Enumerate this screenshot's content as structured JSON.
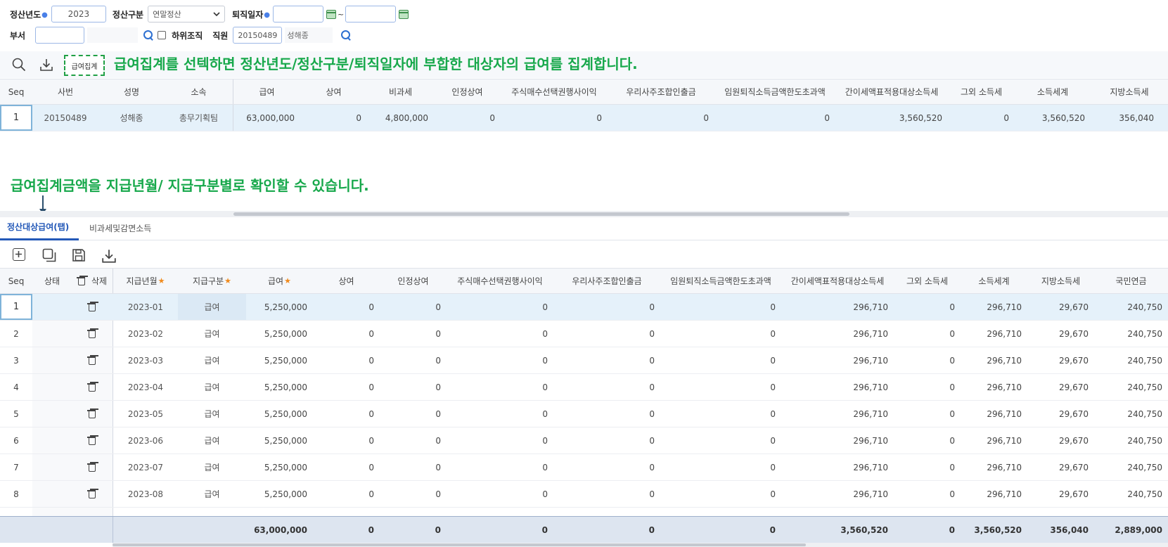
{
  "filter": {
    "year_label": "정산년도",
    "year_value": "2023",
    "type_label": "정산구분",
    "type_value": "연말정산",
    "retire_label": "퇴직일자",
    "tilde": "~",
    "dept_label": "부서",
    "sub_org_label": "하위조직",
    "emp_label": "직원",
    "emp_id": "20150489",
    "emp_name": "성해종"
  },
  "toolbar": {
    "aggregate_label": "급여집계"
  },
  "annotations": {
    "top": "급여집계를 선텍하면 정산년도/정산구분/퇴직일자에 부합한 대상자의 급여를 집계합니다.",
    "mid": "급여집계금액을 지급년월/ 지급구분별로 확인할 수 있습니다."
  },
  "top_grid": {
    "headers": [
      "Seq",
      "사번",
      "성명",
      "소속",
      "급여",
      "상여",
      "비과세",
      "인정상여",
      "주식매수선택권행사이익",
      "우리사주조합인출금",
      "임원퇴직소득금액한도초과액",
      "간이세액표적용대상소득세",
      "그외 소득세",
      "소득세계",
      "지방소득세"
    ],
    "row": [
      "1",
      "20150489",
      "성해종",
      "총무기획팀",
      "63,000,000",
      "0",
      "4,800,000",
      "0",
      "0",
      "0",
      "0",
      "3,560,520",
      "0",
      "3,560,520",
      "356,040"
    ]
  },
  "tabs": [
    "정산대상급여(탭)",
    "비과세및감면소득"
  ],
  "bottom_grid": {
    "headers": [
      "Seq",
      "상태",
      "삭제",
      "지급년월",
      "지급구분",
      "급여",
      "상여",
      "인정상여",
      "주식매수선택권행사이익",
      "우리사주조합인출금",
      "임원퇴직소득금액한도초과액",
      "간이세액표적용대상소득세",
      "그외 소득세",
      "소득세계",
      "지방소득세",
      "국민연금"
    ],
    "rows": [
      [
        "1",
        "2023-01",
        "급여",
        "5,250,000",
        "0",
        "0",
        "0",
        "0",
        "0",
        "296,710",
        "0",
        "296,710",
        "29,670",
        "240,750"
      ],
      [
        "2",
        "2023-02",
        "급여",
        "5,250,000",
        "0",
        "0",
        "0",
        "0",
        "0",
        "296,710",
        "0",
        "296,710",
        "29,670",
        "240,750"
      ],
      [
        "3",
        "2023-03",
        "급여",
        "5,250,000",
        "0",
        "0",
        "0",
        "0",
        "0",
        "296,710",
        "0",
        "296,710",
        "29,670",
        "240,750"
      ],
      [
        "4",
        "2023-04",
        "급여",
        "5,250,000",
        "0",
        "0",
        "0",
        "0",
        "0",
        "296,710",
        "0",
        "296,710",
        "29,670",
        "240,750"
      ],
      [
        "5",
        "2023-05",
        "급여",
        "5,250,000",
        "0",
        "0",
        "0",
        "0",
        "0",
        "296,710",
        "0",
        "296,710",
        "29,670",
        "240,750"
      ],
      [
        "6",
        "2023-06",
        "급여",
        "5,250,000",
        "0",
        "0",
        "0",
        "0",
        "0",
        "296,710",
        "0",
        "296,710",
        "29,670",
        "240,750"
      ],
      [
        "7",
        "2023-07",
        "급여",
        "5,250,000",
        "0",
        "0",
        "0",
        "0",
        "0",
        "296,710",
        "0",
        "296,710",
        "29,670",
        "240,750"
      ],
      [
        "8",
        "2023-08",
        "급여",
        "5,250,000",
        "0",
        "0",
        "0",
        "0",
        "0",
        "296,710",
        "0",
        "296,710",
        "29,670",
        "240,750"
      ]
    ],
    "footer": [
      "63,000,000",
      "0",
      "0",
      "0",
      "0",
      "0",
      "3,560,520",
      "0",
      "3,560,520",
      "356,040",
      "2,889,000"
    ]
  }
}
